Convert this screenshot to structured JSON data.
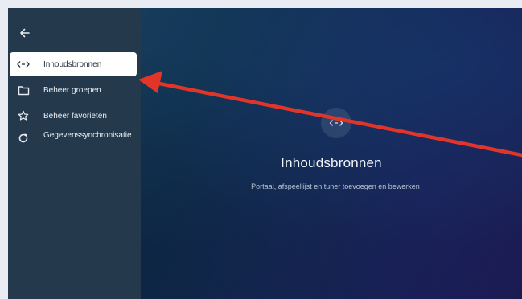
{
  "sidebar": {
    "back_icon": "arrow-left-icon",
    "items": [
      {
        "label": "Inhoudsbronnen",
        "icon": "code-arrows-icon",
        "active": true
      },
      {
        "label": "Beheer groepen",
        "icon": "folder-icon",
        "active": false
      },
      {
        "label": "Beheer favorieten",
        "icon": "star-icon",
        "active": false
      },
      {
        "label": "Gegevenssynchronisatie",
        "icon": "refresh-icon",
        "active": false
      }
    ]
  },
  "main": {
    "icon": "code-arrows-icon",
    "title": "Inhoudsbronnen",
    "description": "Portaal, afspeellijst en tuner toevoegen en bewerken"
  },
  "annotation": {
    "arrow_color": "#e2352a"
  },
  "colors": {
    "sidebar_bg": "#243a4c",
    "active_item_bg": "#ffffff"
  }
}
